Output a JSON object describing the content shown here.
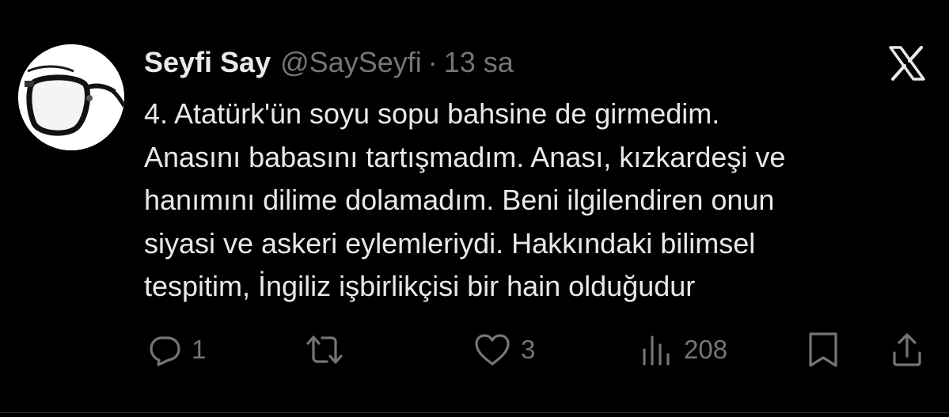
{
  "tweet": {
    "author": {
      "display_name": "Seyfi Say",
      "handle": "@SaySeyfi"
    },
    "separator": "·",
    "time": "13 sa",
    "lines": [
      "4. Atatürk'ün soyu sopu bahsine de girmedim.",
      "Anasını babasını tartışmadım. Anası, kızkardeşi ve",
      "hanımını dilime dolamadım. Beni ilgilendiren onun",
      "siyasi ve askeri eylemleriydi. Hakkındaki bilimsel",
      "tespitim, İngiliz işbirlikçisi bir hain olduğudur"
    ],
    "stats": {
      "replies": "1",
      "retweets": "",
      "likes": "3",
      "views": "208"
    }
  },
  "icons": {
    "platform_logo": "x-logo-icon",
    "reply": "reply-icon",
    "retweet": "retweet-icon",
    "like": "heart-icon",
    "views": "views-icon",
    "bookmark": "bookmark-icon",
    "share": "share-icon"
  },
  "colors": {
    "background": "#000000",
    "primary_text": "#e7e9ea",
    "secondary_text": "#71767b",
    "divider": "#2f3336"
  }
}
